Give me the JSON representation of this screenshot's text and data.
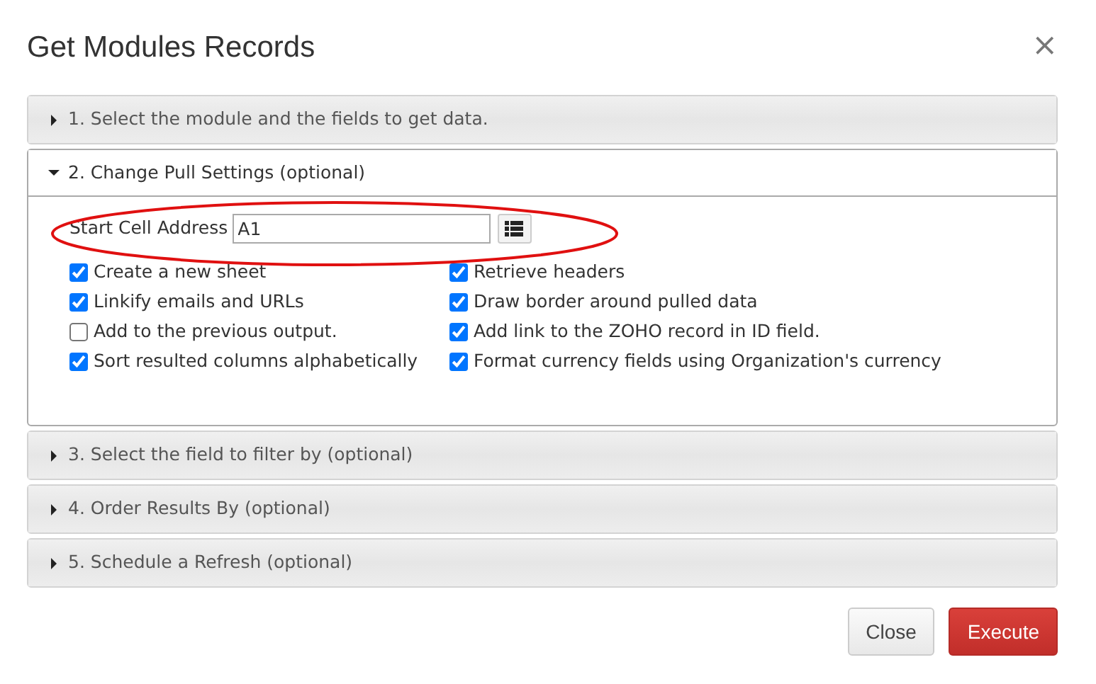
{
  "dialog": {
    "title": "Get Modules Records",
    "close_icon": "×"
  },
  "sections": [
    {
      "label": "1. Select the module and the fields to get data.",
      "expanded": false
    },
    {
      "label": "2. Change Pull Settings (optional)",
      "expanded": true
    },
    {
      "label": "3. Select the field to filter by (optional)",
      "expanded": false
    },
    {
      "label": "4. Order Results By (optional)",
      "expanded": false
    },
    {
      "label": "5. Schedule a Refresh (optional)",
      "expanded": false
    }
  ],
  "pull_settings": {
    "start_cell_label": "Start Cell Address",
    "start_cell_value": "A1",
    "options_left": [
      {
        "label": "Create a new sheet",
        "checked": true
      },
      {
        "label": "Linkify emails and URLs",
        "checked": true
      },
      {
        "label": "Add to the previous output.",
        "checked": false
      },
      {
        "label": "Sort resulted columns alphabetically",
        "checked": true
      }
    ],
    "options_right": [
      {
        "label": "Retrieve headers",
        "checked": true
      },
      {
        "label": "Draw border around pulled data",
        "checked": true
      },
      {
        "label": "Add link to the ZOHO record in ID field.",
        "checked": true
      },
      {
        "label": "Format currency fields using Organization's currency",
        "checked": true
      }
    ]
  },
  "buttons": [
    {
      "label": "Close",
      "kind": "secondary"
    },
    {
      "label": "Execute",
      "kind": "danger"
    }
  ]
}
